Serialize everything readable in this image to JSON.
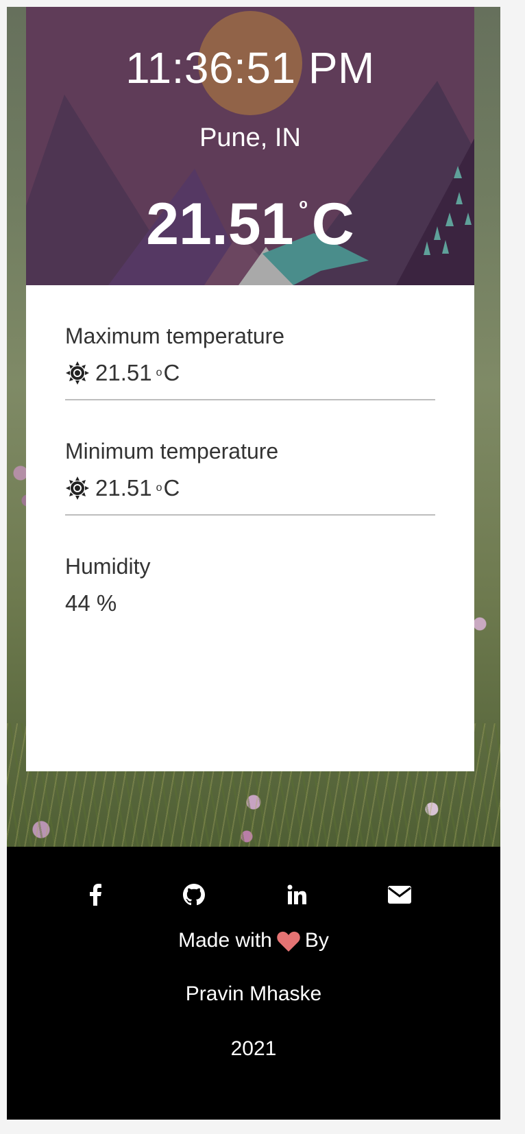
{
  "weather": {
    "time": "11:36:51 PM",
    "location": "Pune, IN",
    "temperature": "21.51",
    "temperature_degree": "o",
    "temperature_unit": "C"
  },
  "details": [
    {
      "label": "Maximum temperature",
      "value": "21.51",
      "unit_o": "o",
      "unit": "C",
      "icon": "sun-icon"
    },
    {
      "label": "Minimum temperature",
      "value": "21.51",
      "unit_o": "o",
      "unit": "C",
      "icon": "sun-icon"
    },
    {
      "label": "Humidity",
      "value": "44 %"
    }
  ],
  "footer": {
    "social_icons": [
      "facebook-icon",
      "github-icon",
      "linkedin-icon",
      "email-icon"
    ],
    "made_with": "Made with",
    "by": "By",
    "author": "Pravin Mhaske",
    "year": "2021"
  },
  "colors": {
    "hero_bg": "#5f3c58",
    "sun": "#a3703f",
    "heart": "#e57373",
    "footer_bg": "#000000"
  }
}
